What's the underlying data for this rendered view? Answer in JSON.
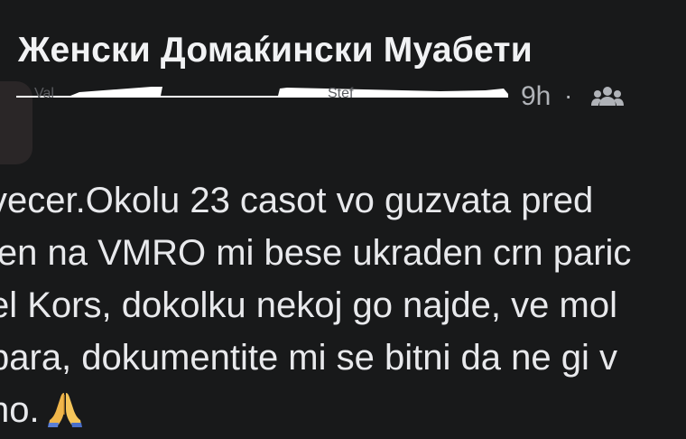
{
  "post": {
    "group_name": "Женски Домаќински Муабети",
    "time_ago": "9h",
    "separator": "·",
    "audience_icon": "group-members-icon",
    "body_lines": [
      "vecer.Okolu 23 casot vo guzvata pred",
      "len na VMRO mi bese ukraden crn paric",
      "el Kors, dokolku nekoj go najde, ve mol",
      "bara, dokumentite mi se bitni da ne gi v",
      "no."
    ],
    "emoji_icon": "folded-hands-icon"
  }
}
